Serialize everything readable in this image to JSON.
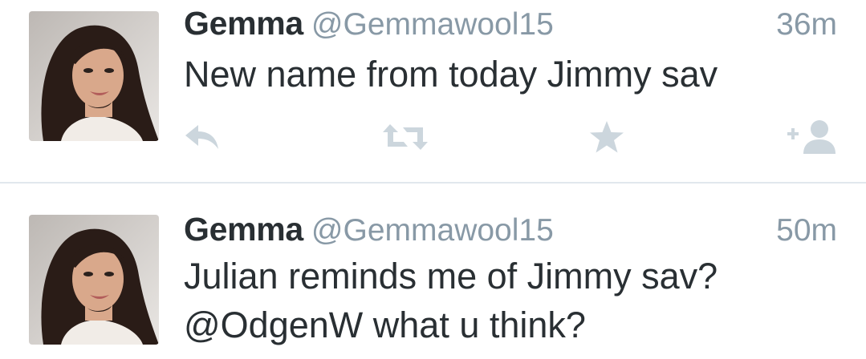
{
  "tweets": [
    {
      "name": "Gemma",
      "handle": "@Gemmawool15",
      "time": "36m",
      "text_lines": [
        "New name from today Jimmy sav"
      ],
      "actions": [
        "reply-icon",
        "retweet-icon",
        "favorite-star-icon",
        "follow-add-user-icon"
      ]
    },
    {
      "name": "Gemma",
      "handle": "@Gemmawool15",
      "time": "50m",
      "text_lines": [
        "Julian reminds me of Jimmy sav?",
        "@OdgenW what u think?"
      ]
    }
  ],
  "colors": {
    "name": "#292f33",
    "meta": "#8899a6",
    "icon": "#ccd6dd",
    "divider": "#e1e8ed"
  }
}
